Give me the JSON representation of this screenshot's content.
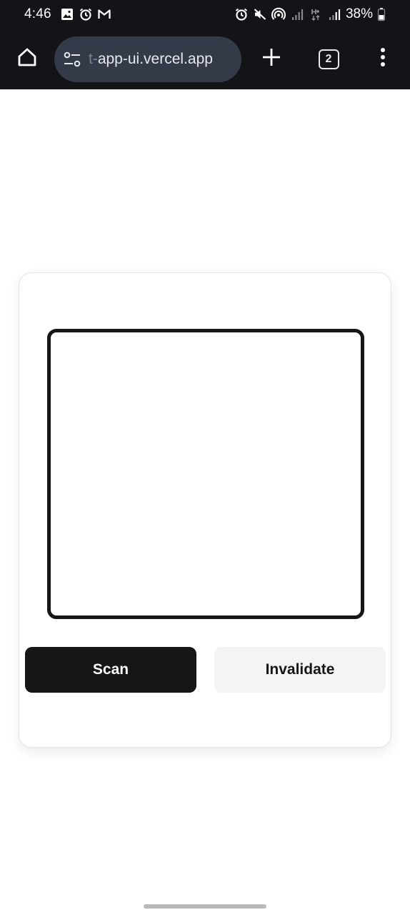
{
  "status_bar": {
    "time": "4:46",
    "battery": "38%",
    "left_icons": [
      "image-icon",
      "alarm-icon",
      "gmail-icon"
    ],
    "right_icons": [
      "alarm-icon",
      "mute-icon",
      "hotspot-icon",
      "signal-icon",
      "data-icon",
      "signal-icon",
      "battery-icon"
    ]
  },
  "toolbar": {
    "url_faded": "t-",
    "url": "app-ui.vercel.app",
    "tab_count": "2"
  },
  "card": {
    "scan_label": "Scan",
    "invalidate_label": "Invalidate"
  },
  "colors": {
    "chrome_bg": "#131417",
    "url_pill_bg": "#343a48",
    "primary_button": "#161616",
    "secondary_button": "#f4f4f5"
  }
}
